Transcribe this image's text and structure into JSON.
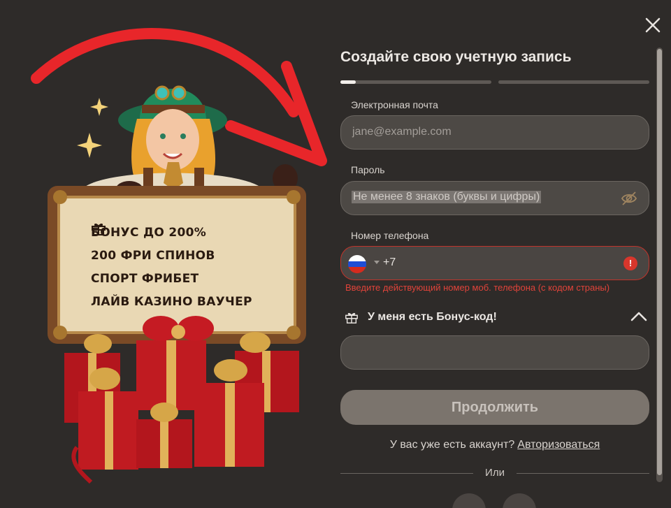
{
  "promo": {
    "perks": [
      {
        "label": "БОНУС ДО 200%"
      },
      {
        "label": "200 ФРИ СПИНОВ"
      },
      {
        "label": "СПОРТ ФРИБЕТ"
      },
      {
        "label": "ЛАЙВ КАЗИНО ВАУЧЕР"
      }
    ]
  },
  "form": {
    "title": "Создайте свою учетную запись",
    "step_progress": [
      0.1,
      0
    ],
    "email": {
      "label": "Электронная почта",
      "placeholder": "jane@example.com"
    },
    "password": {
      "label": "Пароль",
      "placeholder": "Не менее 8 знаков (буквы и цифры)"
    },
    "phone": {
      "label": "Номер телефона",
      "dial_code": "+7",
      "country": "Russia",
      "error": "Введите действующий номер моб. телефона (с кодом страны)",
      "error_icon": "!"
    },
    "bonus": {
      "label": "У меня есть Бонус-код!",
      "value": ""
    },
    "continue_label": "Продолжить",
    "have_account": "У вас уже есть аккаунт?",
    "login_link": "Авторизоваться",
    "or_label": "Или"
  },
  "colors": {
    "background": "#2e2b29",
    "input_bg": "#4d4945",
    "error": "#d8362c",
    "arrow": "#e8262a",
    "button_disabled": "#7b746d"
  },
  "icons": [
    "close-icon",
    "eye-off-icon",
    "gift-icon",
    "chevron-up-icon",
    "error-icon",
    "russia-flag-icon"
  ]
}
